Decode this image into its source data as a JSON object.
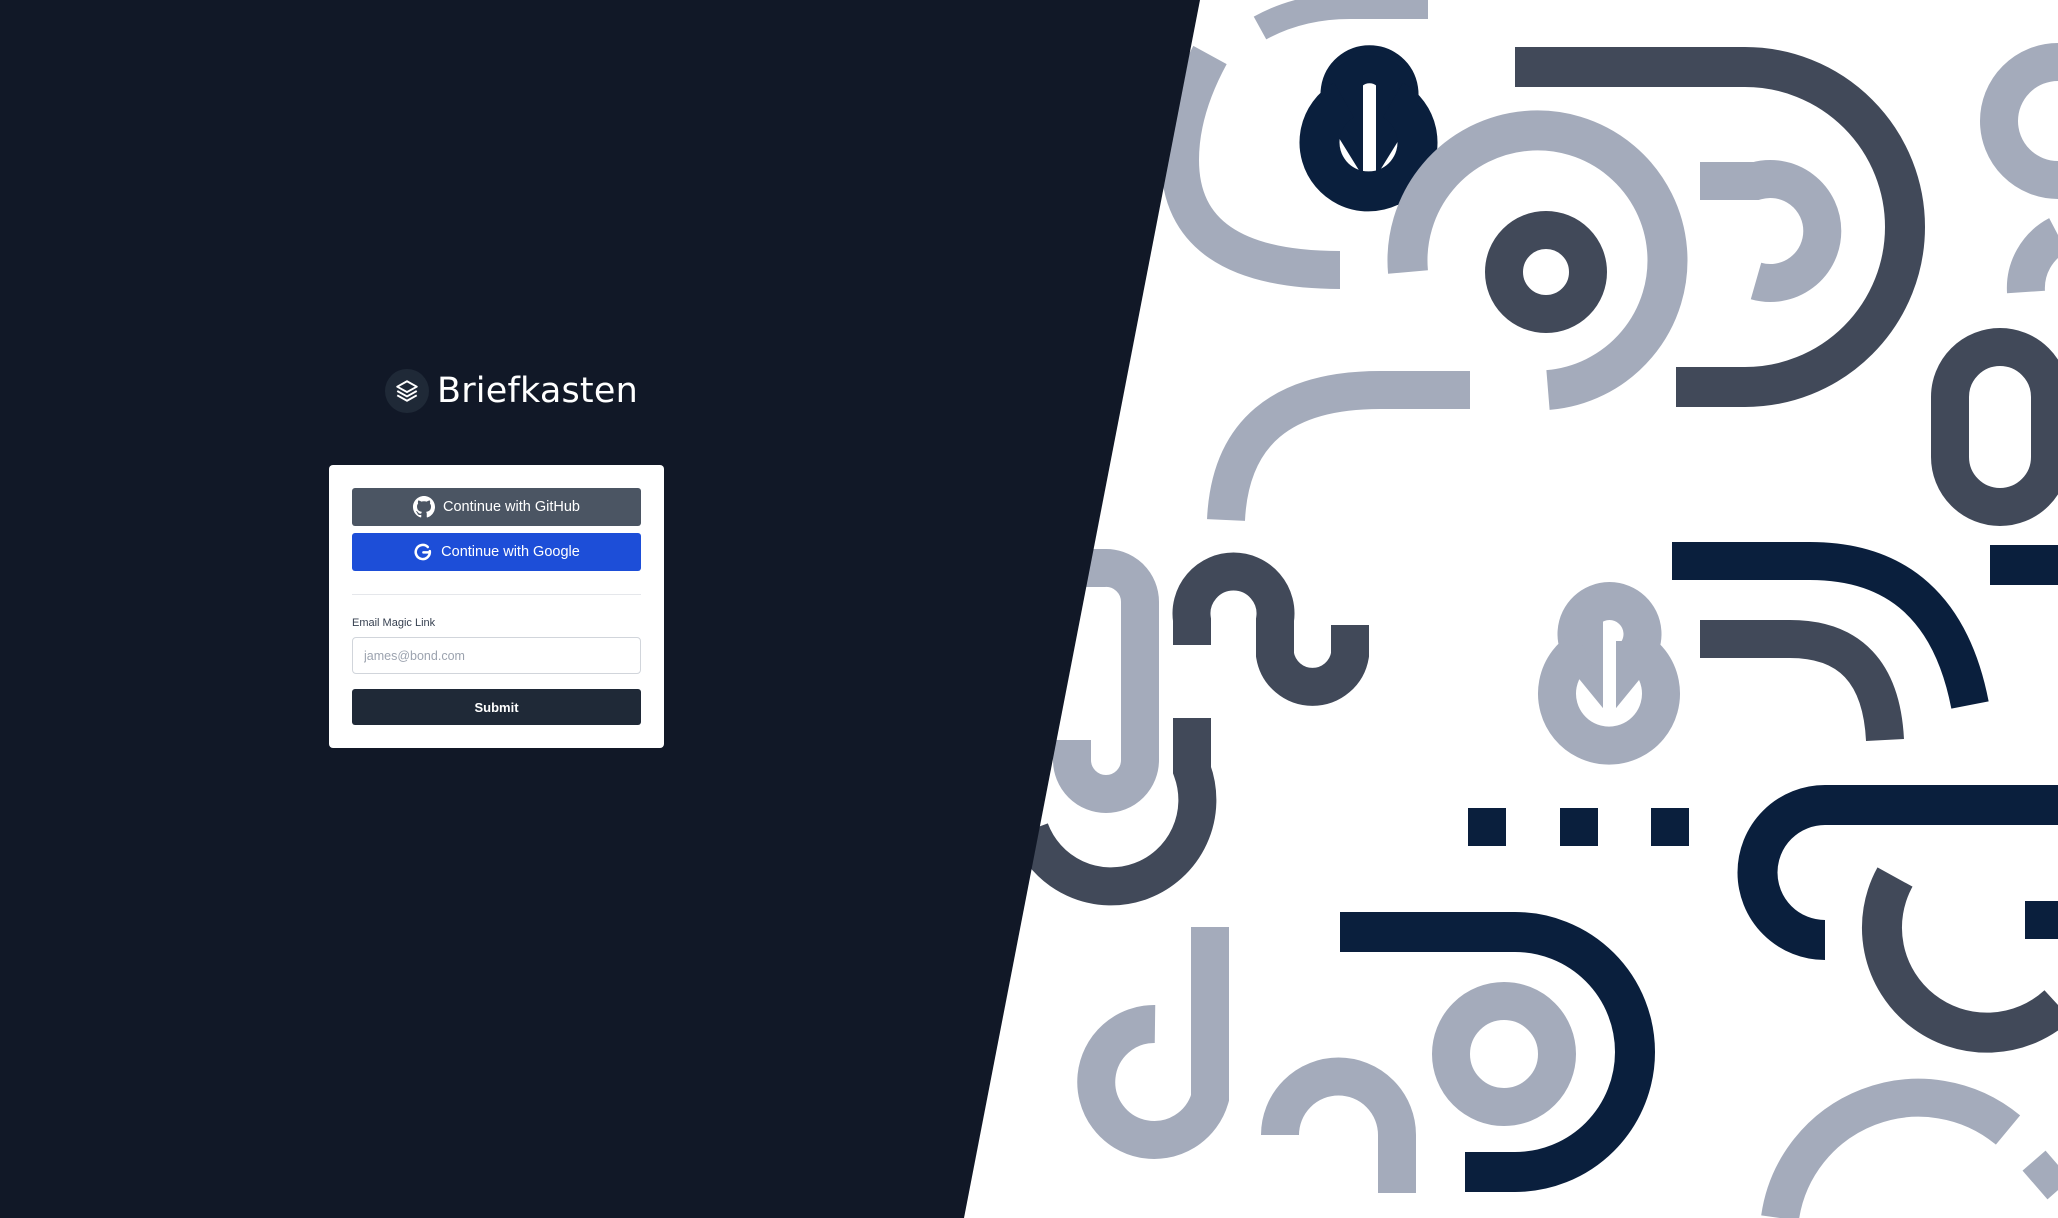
{
  "brand": {
    "name": "Briefkasten",
    "icon": "stacked-layers-icon"
  },
  "login": {
    "github_label": "Continue with GitHub",
    "github_icon": "github-icon",
    "google_label": "Continue with Google",
    "google_icon": "google-icon",
    "email_label": "Email Magic Link",
    "email_placeholder": "james@bond.com",
    "email_value": "",
    "submit_label": "Submit"
  },
  "colors": {
    "dark_background": "#111827",
    "github_button": "#4b5563",
    "google_button": "#1d4ed8",
    "submit_button": "#1f2937",
    "pattern_navy": "#0a1f3d",
    "pattern_slate": "#414959",
    "pattern_light": "#a4abbb"
  }
}
